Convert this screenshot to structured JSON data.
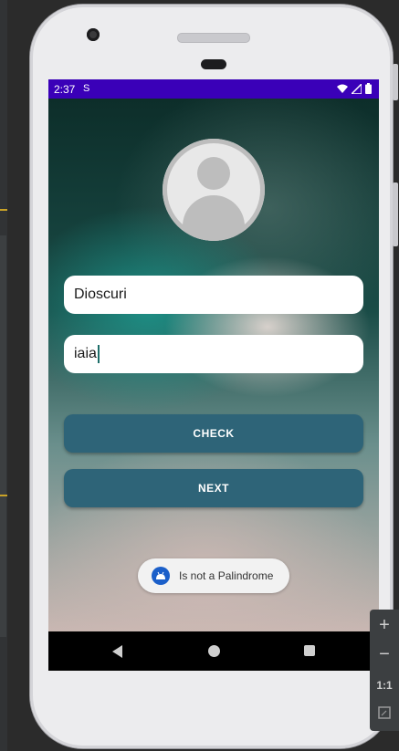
{
  "status_bar": {
    "time": "2:37",
    "sim_icon": "S"
  },
  "form": {
    "name_value": "Dioscuri",
    "text_value": "iaia"
  },
  "buttons": {
    "check_label": "CHECK",
    "next_label": "NEXT"
  },
  "toast": {
    "message": "Is not a Palindrome"
  },
  "zoom_toolbar": {
    "zoom_in": "+",
    "zoom_out": "−",
    "one_to_one": "1:1"
  },
  "colors": {
    "status_bar": "#3a00b8",
    "button": "#2e6478",
    "toast_icon": "#1b5fc9"
  },
  "icons": {
    "status": [
      "wifi-icon",
      "signal-icon",
      "battery-icon"
    ],
    "nav": [
      "back-icon",
      "home-icon",
      "recents-icon"
    ],
    "toast": "android-icon",
    "profile": "avatar-icon"
  }
}
